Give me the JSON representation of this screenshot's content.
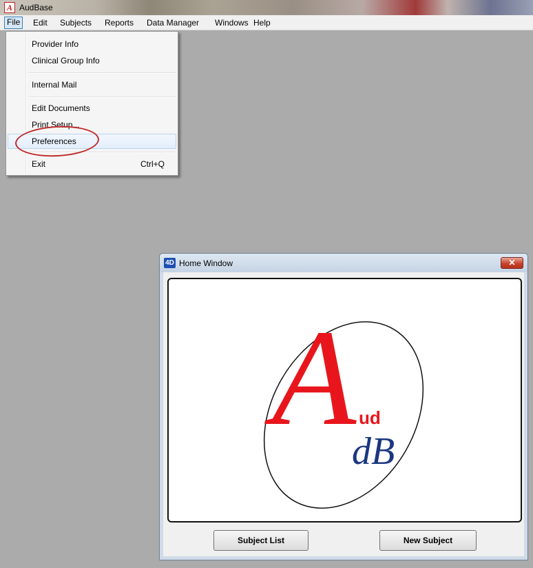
{
  "app": {
    "title": "AudBase",
    "icon": "app-logo-icon"
  },
  "menubar": {
    "items": [
      "File",
      "Edit",
      "Subjects",
      "Reports",
      "Data Manager",
      "Windows",
      "Help"
    ],
    "active": "File"
  },
  "file_menu": {
    "items": [
      {
        "label": "Provider Info",
        "shortcut": ""
      },
      {
        "label": "Clinical Group Info",
        "shortcut": ""
      },
      {
        "label": "Internal Mail",
        "shortcut": ""
      },
      {
        "label": "Edit Documents",
        "shortcut": ""
      },
      {
        "label": "Print Setup...",
        "shortcut": ""
      },
      {
        "label": "Preferences",
        "shortcut": ""
      },
      {
        "label": "Exit",
        "shortcut": "Ctrl+Q"
      }
    ],
    "highlighted": "Preferences",
    "annotation_color": "#c02a2a"
  },
  "home_window": {
    "title": "Home Window",
    "close_label": "✕",
    "logo": {
      "big_letter": "A",
      "small_text": "ud",
      "sub_text": "dB",
      "red": "#e8161c",
      "blue": "#1a3780"
    },
    "buttons": {
      "subject_list": "Subject List",
      "new_subject": "New Subject"
    }
  }
}
